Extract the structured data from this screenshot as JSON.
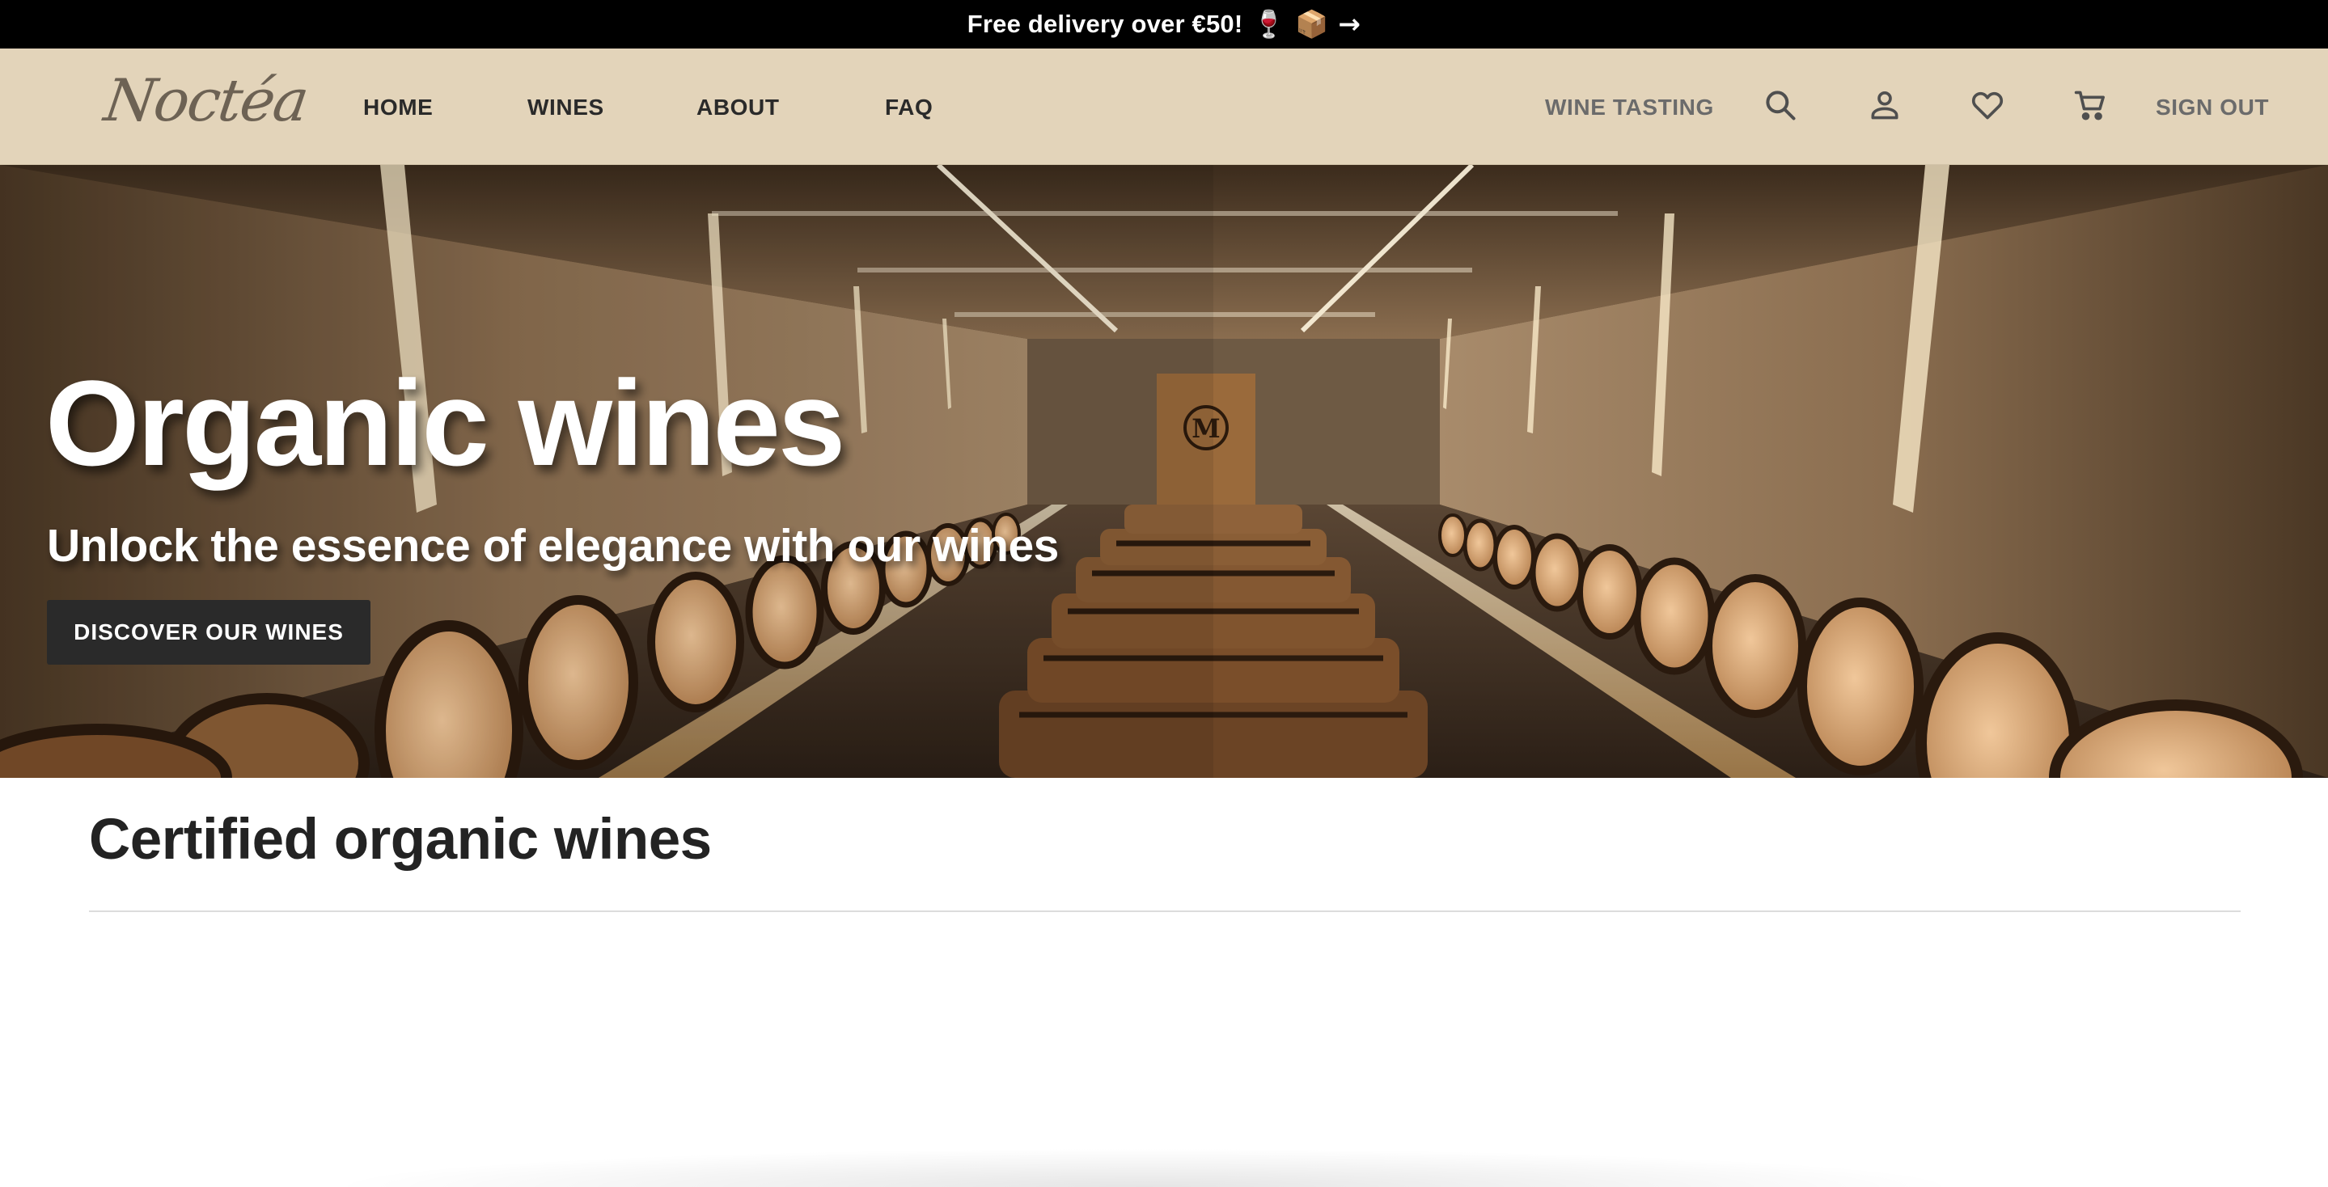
{
  "announcement": {
    "text": "Free delivery over €50!",
    "emoji": "🍷 📦 →"
  },
  "header": {
    "logo": "Noctéa",
    "nav": [
      "HOME",
      "WINES",
      "ABOUT",
      "FAQ"
    ],
    "wine_tasting": "WINE TASTING",
    "sign_out": "SIGN OUT",
    "icons": [
      "search-icon",
      "user-icon",
      "heart-icon",
      "cart-icon"
    ]
  },
  "hero": {
    "title": "Organic wines",
    "subtitle": "Unlock the essence of elegance with our wines",
    "cta": "DISCOVER OUR WINES",
    "cellar_emblem": "M"
  },
  "section": {
    "title": "Certified organic wines"
  },
  "colors": {
    "announcement_bg": "#000000",
    "header_bg": "#e3d4ba",
    "logo": "#6d6254",
    "nav_text": "#2a2a2a",
    "nav_right_text": "#6b6b6b",
    "button_bg": "#2a2a2a",
    "title_text": "#232323"
  }
}
